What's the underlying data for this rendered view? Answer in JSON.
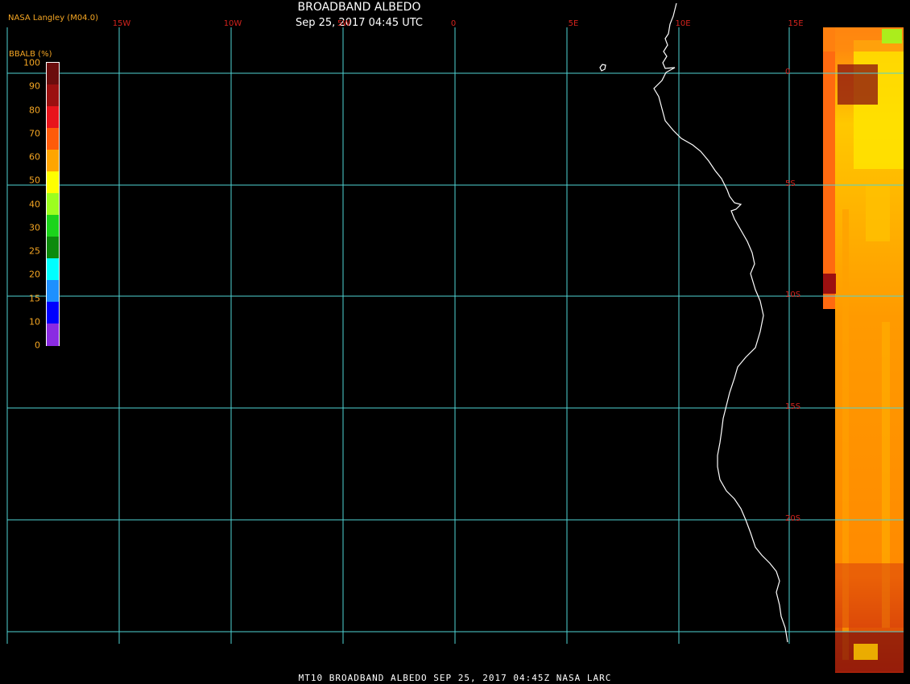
{
  "header": {
    "title": "BROADBAND ALBEDO",
    "subtitle": "Sep 25, 2017 04:45 UTC",
    "source": "NASA Langley (M04.0)"
  },
  "footer": {
    "caption": "MT10  BROADBAND ALBEDO   SEP 25, 2017 04:45Z   NASA LARC"
  },
  "map": {
    "longitude_labels": [
      "15W",
      "10W",
      "5W",
      "0",
      "5E",
      "10E",
      "15E"
    ],
    "latitude_labels": [
      "0",
      "5S",
      "10S",
      "15S",
      "20S"
    ],
    "grid_color": "#4fd4d4",
    "coastline_color": "#ffffff",
    "label_color": "#d4231d"
  },
  "legend": {
    "title": "BBALB (%)",
    "ticks": [
      "100",
      "90",
      "80",
      "70",
      "60",
      "50",
      "40",
      "30",
      "25",
      "20",
      "15",
      "10",
      "0"
    ],
    "colors": [
      "#6b0d0d",
      "#9b1010",
      "#e8141c",
      "#ff5b0a",
      "#ffa500",
      "#ffff00",
      "#9cff1f",
      "#1bd41b",
      "#0c8a0c",
      "#00ffff",
      "#1e90ff",
      "#0000ff",
      "#8a2be2"
    ]
  }
}
